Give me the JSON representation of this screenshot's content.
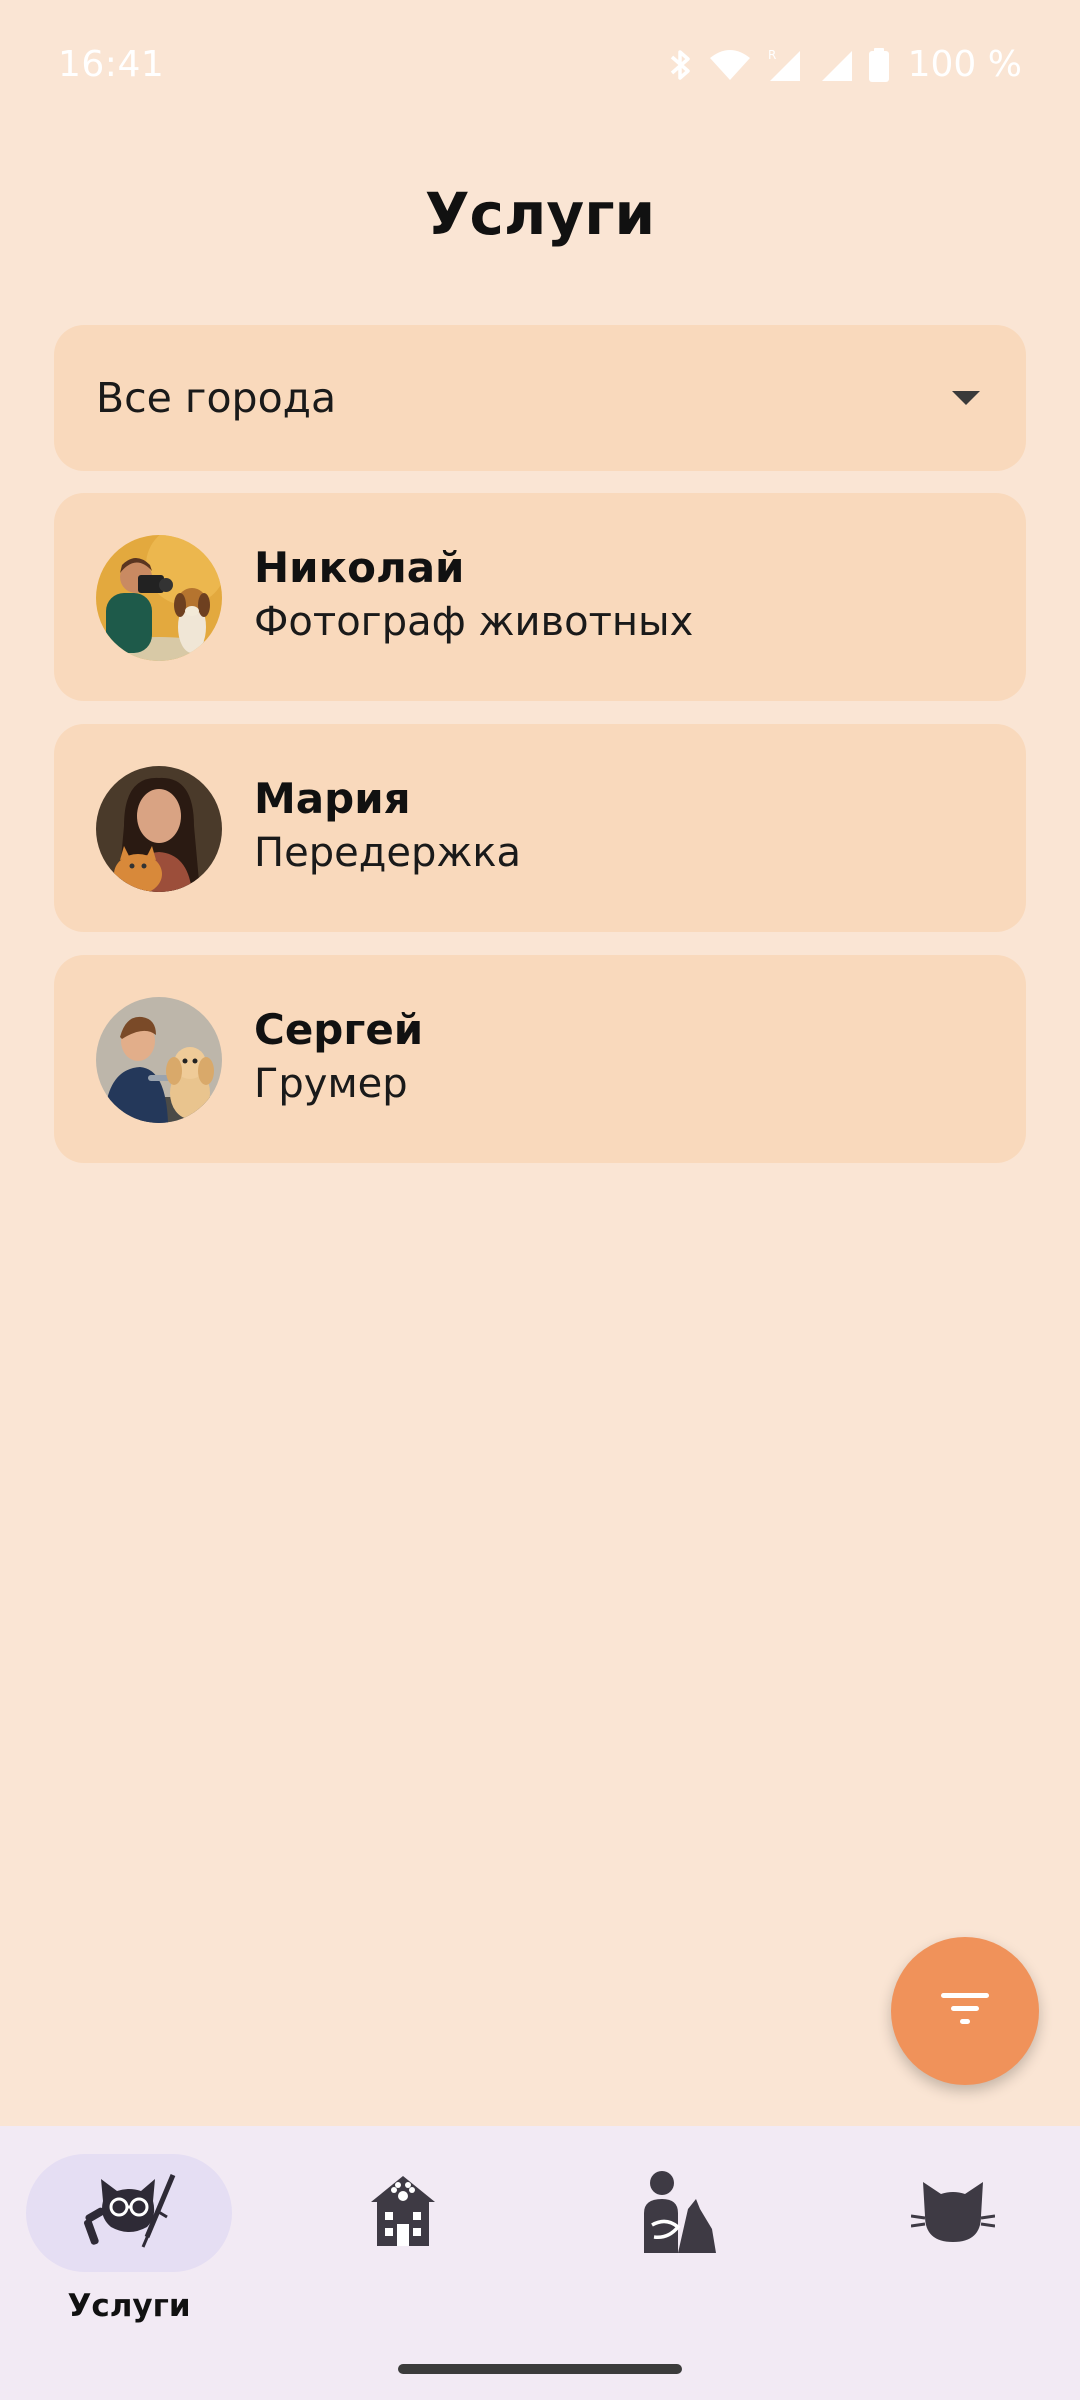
{
  "status_bar": {
    "time": "16:41",
    "battery": "100 %",
    "icons": [
      "bluetooth-icon",
      "wifi-icon",
      "signal-r-icon",
      "signal-icon",
      "battery-icon"
    ]
  },
  "header": {
    "title": "Услуги"
  },
  "city_filter": {
    "selected": "Все города"
  },
  "services": [
    {
      "name": "Николай",
      "role": "Фотограф животных"
    },
    {
      "name": "Мария",
      "role": "Передержка"
    },
    {
      "name": "Сергей",
      "role": "Грумер"
    }
  ],
  "fab": {
    "icon": "filter-icon"
  },
  "bottom_nav": {
    "items": [
      {
        "label": "Услуги",
        "icon": "cat-vet-icon",
        "active": true
      },
      {
        "label": "",
        "icon": "pet-shelter-icon",
        "active": false
      },
      {
        "label": "",
        "icon": "person-with-pet-icon",
        "active": false
      },
      {
        "label": "",
        "icon": "cat-face-icon",
        "active": false
      }
    ]
  },
  "colors": {
    "background": "#FAE5D4",
    "card": "#F9D9BC",
    "accent": "#F0925A",
    "nav_background": "#F2EAF4",
    "nav_active_pill": "#E5DEF3"
  }
}
